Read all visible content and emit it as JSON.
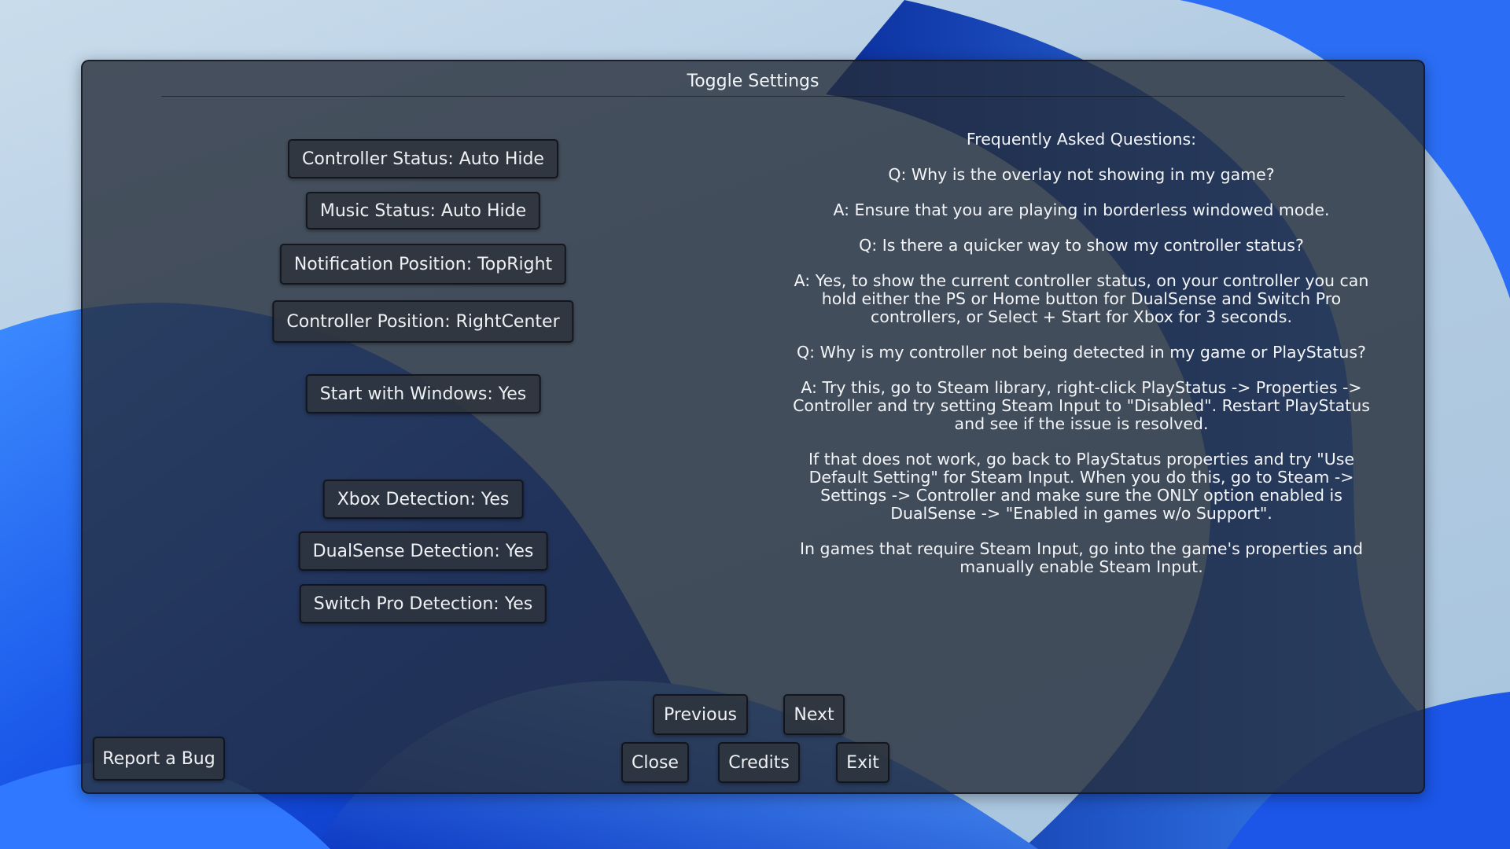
{
  "window": {
    "title": "Toggle Settings"
  },
  "settings": [
    {
      "label": "Controller Status: Auto Hide",
      "name": "controller-status-button"
    },
    {
      "label": "Music Status: Auto Hide",
      "name": "music-status-button"
    },
    {
      "label": "Notification Position: TopRight",
      "name": "notification-position-button"
    },
    {
      "label": "Controller Position: RightCenter",
      "name": "controller-position-button"
    },
    {
      "label": "Start with Windows: Yes",
      "name": "start-with-windows-button"
    },
    {
      "label": "Xbox Detection: Yes",
      "name": "xbox-detection-button"
    },
    {
      "label": "DualSense Detection: Yes",
      "name": "dualsense-detection-button"
    },
    {
      "label": "Switch Pro Detection: Yes",
      "name": "switch-pro-detection-button"
    }
  ],
  "faq": {
    "heading": "Frequently Asked Questions:",
    "paragraphs": [
      "Q: Why is the overlay not showing in my game?",
      "A: Ensure that you are playing in borderless windowed mode.",
      "Q: Is there a quicker way to show my controller status?",
      "A: Yes, to show the current controller status, on your controller you can hold either the PS or Home button for DualSense and Switch Pro controllers, or Select + Start for Xbox for 3 seconds.",
      "Q: Why is my controller not being detected in my game or PlayStatus?",
      "A: Try this, go to Steam library, right-click PlayStatus -> Properties -> Controller and try setting Steam Input to \"Disabled\". Restart PlayStatus and see if the issue is resolved.",
      "If that does not work, go back to PlayStatus properties and try \"Use Default Setting\" for Steam Input. When you do this, go to Steam -> Settings -> Controller and make sure the ONLY option enabled is DualSense -> \"Enabled in games w/o Support\".",
      "In games that require Steam Input, go into the game's properties and manually enable Steam Input."
    ]
  },
  "nav": {
    "previous": "Previous",
    "next": "Next",
    "close": "Close",
    "credits": "Credits",
    "exit": "Exit",
    "report_bug": "Report a Bug"
  },
  "colors": {
    "panel": "#262d3a",
    "button": "#2e343e",
    "text": "#f2f4f7",
    "wallpaper_blue": "#1a5cf0"
  }
}
